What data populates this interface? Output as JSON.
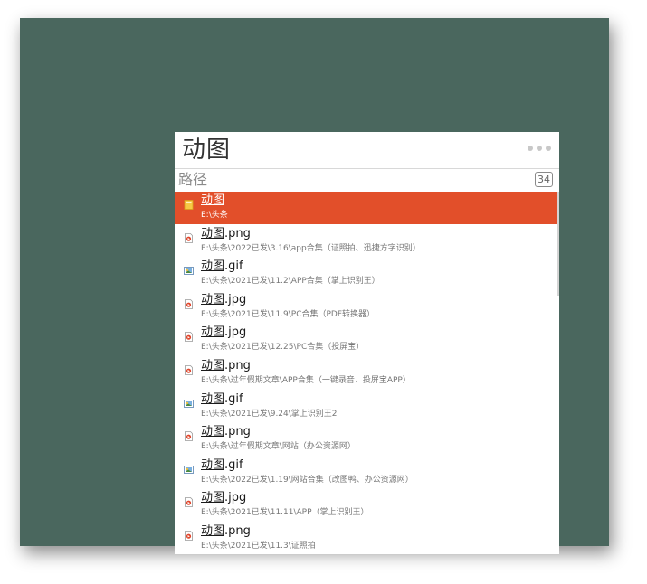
{
  "search": {
    "query": "动图",
    "menu_icon": "more-dots-icon"
  },
  "filter": {
    "label": "路径",
    "count": "34"
  },
  "colors": {
    "desktop": "#4a675e",
    "selection": "#e24f2a"
  },
  "results": [
    {
      "highlight": "动图",
      "rest": "",
      "path": "E:\\头条",
      "icon": "folder-icon",
      "selected": true
    },
    {
      "highlight": "动图",
      "rest": ".png",
      "path": "E:\\头条\\2022已发\\3.16\\app合集（证照拍、迅捷方字识别）",
      "icon": "png-file-icon"
    },
    {
      "highlight": "动图",
      "rest": ".gif",
      "path": "E:\\头条\\2021已发\\11.2\\APP合集（掌上识别王）",
      "icon": "gif-file-icon"
    },
    {
      "highlight": "动图",
      "rest": ".jpg",
      "path": "E:\\头条\\2021已发\\11.9\\PC合集（PDF转换器）",
      "icon": "jpg-file-icon"
    },
    {
      "highlight": "动图",
      "rest": ".jpg",
      "path": "E:\\头条\\2021已发\\12.25\\PC合集（投屏宝）",
      "icon": "jpg-file-icon"
    },
    {
      "highlight": "动图",
      "rest": ".png",
      "path": "E:\\头条\\过年假期文章\\APP合集（一键录音、投屏宝APP）",
      "icon": "png-file-icon"
    },
    {
      "highlight": "动图",
      "rest": ".gif",
      "path": "E:\\头条\\2021已发\\9.24\\掌上识别王2",
      "icon": "gif-file-icon"
    },
    {
      "highlight": "动图",
      "rest": ".png",
      "path": "E:\\头条\\过年假期文章\\网站（办公资源网）",
      "icon": "png-file-icon"
    },
    {
      "highlight": "动图",
      "rest": ".gif",
      "path": "E:\\头条\\2022已发\\1.19\\网站合集（改图鸭、办公资源网）",
      "icon": "gif-file-icon"
    },
    {
      "highlight": "动图",
      "rest": ".jpg",
      "path": "E:\\头条\\2021已发\\11.11\\APP（掌上识别王）",
      "icon": "jpg-file-icon"
    },
    {
      "highlight": "动图",
      "rest": ".png",
      "path": "E:\\头条\\2021已发\\11.3\\证照拍",
      "icon": "png-file-icon"
    }
  ]
}
